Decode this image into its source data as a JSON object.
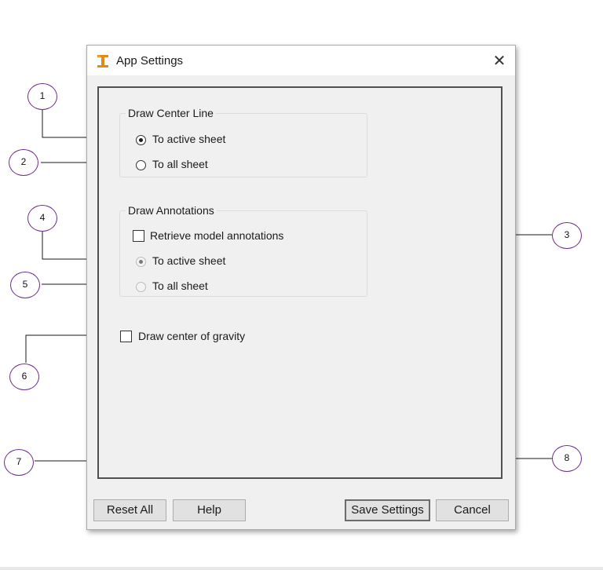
{
  "dialog": {
    "title": "App Settings",
    "icon": "app-logo-icon",
    "close_glyph": "✕",
    "draw_center_line": {
      "legend": "Draw Center Line",
      "options": [
        {
          "label": "To active sheet",
          "selected": true
        },
        {
          "label": "To all sheet",
          "selected": false
        }
      ]
    },
    "draw_annotations": {
      "legend": "Draw Annotations",
      "retrieve_label": "Retrieve model annotations",
      "retrieve_checked": false,
      "options": [
        {
          "label": "To active sheet",
          "selected": true,
          "disabled": true
        },
        {
          "label": "To all sheet",
          "selected": false,
          "disabled": true
        }
      ]
    },
    "gravity": {
      "label": "Draw center of gravity",
      "checked": false
    },
    "buttons": {
      "reset_all": "Reset All",
      "help": "Help",
      "save_settings": "Save Settings",
      "cancel": "Cancel"
    }
  },
  "callouts": [
    "1",
    "2",
    "3",
    "4",
    "5",
    "6",
    "7",
    "8"
  ],
  "colors": {
    "callout_border": "#6b2d8a",
    "icon_orange": "#e08a1e"
  }
}
